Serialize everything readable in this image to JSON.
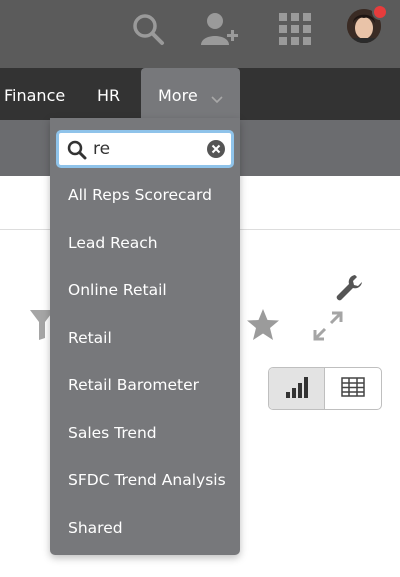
{
  "topbar": {
    "icons": [
      "search-icon",
      "add-user-icon",
      "apps-grid-icon"
    ],
    "notification_color": "#e63c3c"
  },
  "nav": {
    "items": [
      {
        "label": "Finance"
      },
      {
        "label": "HR"
      }
    ],
    "more": {
      "label": "More"
    }
  },
  "dropdown": {
    "search": {
      "value": "re"
    },
    "items": [
      {
        "label": "All Reps Scorecard"
      },
      {
        "label": "Lead Reach"
      },
      {
        "label": "Online Retail"
      },
      {
        "label": "Retail"
      },
      {
        "label": "Retail Barometer"
      },
      {
        "label": "Sales Trend"
      },
      {
        "label": "SFDC Trend Analysis"
      },
      {
        "label": "Shared"
      }
    ]
  },
  "toolbar": {
    "icons": [
      "wrench-icon",
      "star-icon",
      "expand-icon",
      "filter-icon",
      "bar-chart-icon",
      "table-icon"
    ]
  },
  "colors": {
    "topbar_bg": "#5b5b5b",
    "navbar_bg": "#333333",
    "dropdown_bg": "#77787b",
    "search_focus": "#8fc3ea"
  }
}
